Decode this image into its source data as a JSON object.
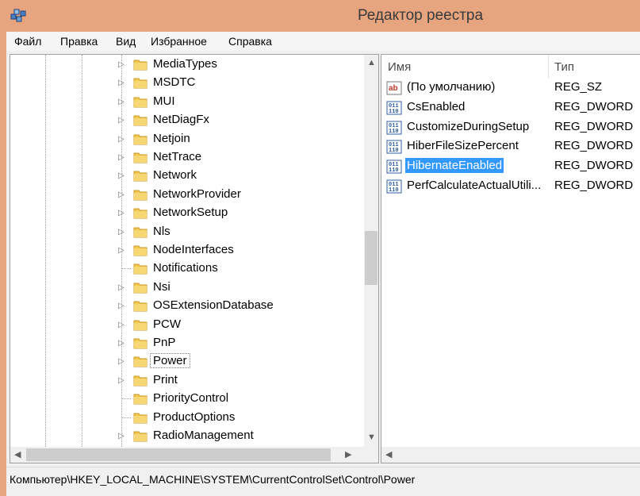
{
  "window": {
    "title": "Редактор реестра"
  },
  "menu": [
    "Файл",
    "Правка",
    "Вид",
    "Избранное",
    "Справка"
  ],
  "tree": {
    "items": [
      {
        "label": "MediaTypes",
        "expandable": true
      },
      {
        "label": "MSDTC",
        "expandable": true
      },
      {
        "label": "MUI",
        "expandable": true
      },
      {
        "label": "NetDiagFx",
        "expandable": true
      },
      {
        "label": "Netjoin",
        "expandable": true
      },
      {
        "label": "NetTrace",
        "expandable": true
      },
      {
        "label": "Network",
        "expandable": true
      },
      {
        "label": "NetworkProvider",
        "expandable": true
      },
      {
        "label": "NetworkSetup",
        "expandable": true
      },
      {
        "label": "Nls",
        "expandable": true
      },
      {
        "label": "NodeInterfaces",
        "expandable": true
      },
      {
        "label": "Notifications",
        "expandable": false
      },
      {
        "label": "Nsi",
        "expandable": true
      },
      {
        "label": "OSExtensionDatabase",
        "expandable": true
      },
      {
        "label": "PCW",
        "expandable": true
      },
      {
        "label": "PnP",
        "expandable": true
      },
      {
        "label": "Power",
        "expandable": true,
        "selected": true
      },
      {
        "label": "Print",
        "expandable": true
      },
      {
        "label": "PriorityControl",
        "expandable": false
      },
      {
        "label": "ProductOptions",
        "expandable": false
      },
      {
        "label": "RadioManagement",
        "expandable": true
      }
    ]
  },
  "list": {
    "columns": {
      "name": "Имя",
      "type": "Тип"
    },
    "rows": [
      {
        "name": "(По умолчанию)",
        "type": "REG_SZ",
        "icon": "string-value-icon"
      },
      {
        "name": "CsEnabled",
        "type": "REG_DWORD",
        "icon": "binary-value-icon"
      },
      {
        "name": "CustomizeDuringSetup",
        "type": "REG_DWORD",
        "icon": "binary-value-icon"
      },
      {
        "name": "HiberFileSizePercent",
        "type": "REG_DWORD",
        "icon": "binary-value-icon"
      },
      {
        "name": "HibernateEnabled",
        "type": "REG_DWORD",
        "icon": "binary-value-icon",
        "selected": true
      },
      {
        "name": "PerfCalculateActualUtili...",
        "type": "REG_DWORD",
        "icon": "binary-value-icon"
      }
    ]
  },
  "status": {
    "path": "Компьютер\\HKEY_LOCAL_MACHINE\\SYSTEM\\CurrentControlSet\\Control\\Power"
  },
  "colors": {
    "titlebar": "#e6a57e",
    "selection": "#3399ff",
    "folder": "#f2c94c"
  }
}
